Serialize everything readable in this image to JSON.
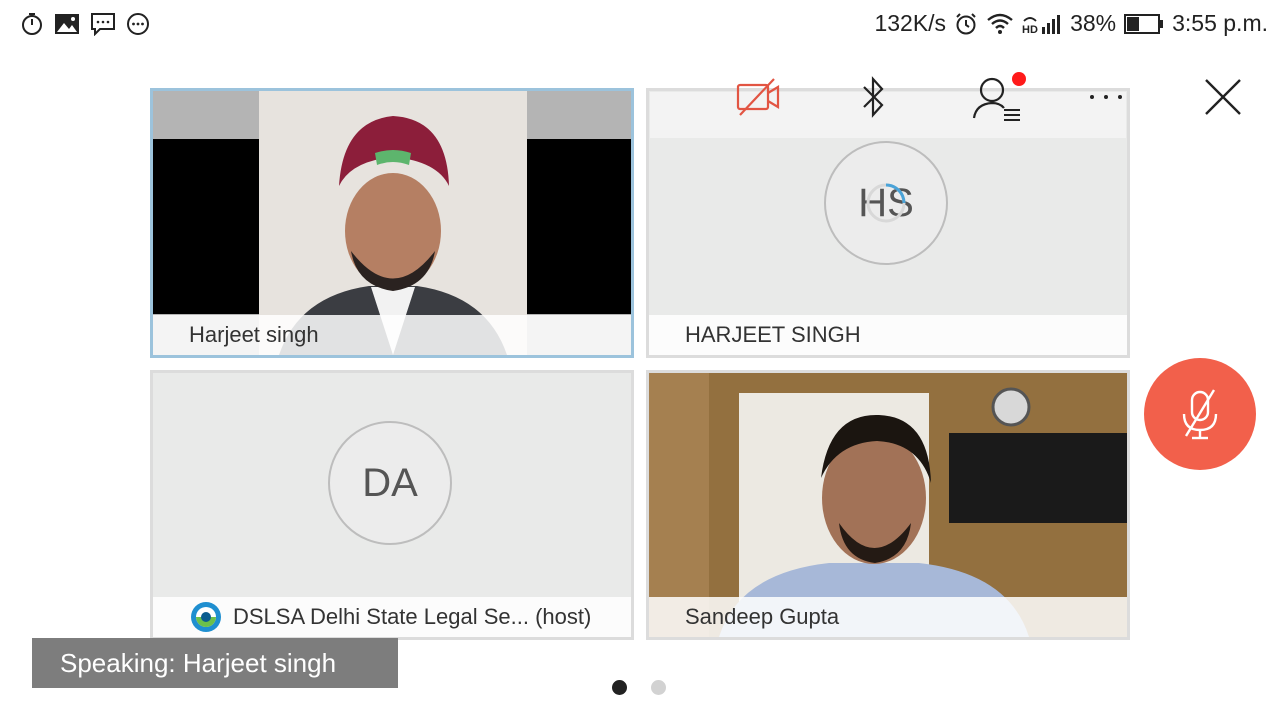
{
  "status_bar": {
    "icons_left": [
      "stopwatch-icon",
      "gallery-icon",
      "message-icon",
      "more-circle-icon"
    ],
    "net_speed": "132K/s",
    "battery_percent": "38%",
    "time": "3:55 p.m.",
    "icons_right": [
      "alarm-icon",
      "wifi-icon",
      "hd-signal-icon",
      "battery-icon"
    ]
  },
  "toolbar": {
    "icons": [
      "video-off-icon",
      "bluetooth-icon",
      "participants-icon",
      "more-horizontal-icon",
      "close-icon"
    ],
    "notification_dot_color": "#ff1a1a"
  },
  "tiles": [
    {
      "name": "Harjeet  singh",
      "type": "video",
      "active": true
    },
    {
      "name": "HARJEET SINGH",
      "type": "avatar",
      "initials": "HS"
    },
    {
      "name": "DSLSA Delhi State Legal Se... (host)",
      "type": "avatar",
      "initials": "DA",
      "host_icon": "webex-logo-icon"
    },
    {
      "name": "Sandeep Gupta",
      "type": "video"
    }
  ],
  "mic_button": {
    "icon": "mic-muted-icon",
    "color": "#f2604b"
  },
  "speaking_banner": "Speaking: Harjeet  singh",
  "pagination": {
    "pages": 2,
    "current": 1
  }
}
